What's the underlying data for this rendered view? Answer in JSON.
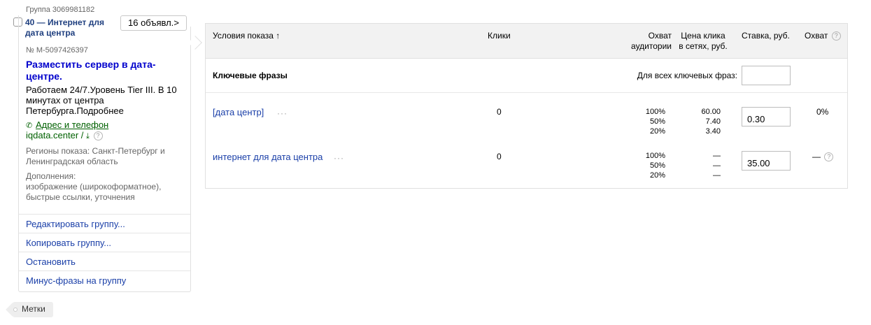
{
  "group": {
    "id_label": "Группа 3069981182",
    "name": "40 — Интернет для дата центра",
    "ads_button": "16 объявл.",
    "ads_chevron": ">"
  },
  "ad": {
    "number": "№ M-5097426397",
    "title": "Разместить сервер в дата-центре.",
    "text": "Работаем 24/7.Уровень Tier III. В 10 минутах от центра Петербурга.Подробнее",
    "contacts_link": "Адрес и телефон",
    "domain": "iqdata.center /",
    "regions": "Регионы показа: Санкт-Петербург и Ленинградская область",
    "extras_label": "Дополнения:",
    "extras": "изображение (широкоформатное), быстрые ссылки, уточнения",
    "help_glyph": "?"
  },
  "actions": [
    "Редактировать группу...",
    "Копировать группу...",
    "Остановить",
    "Минус-фразы на группу"
  ],
  "tags_label": "Метки",
  "table": {
    "headers": {
      "conditions": "Условия показа",
      "sort_arrow": "↑",
      "clicks": "Клики",
      "reach_line1": "Охват",
      "reach_line2": "аудитории",
      "cpc_line1": "Цена клика",
      "cpc_line2": "в сетях, руб.",
      "bid": "Ставка, руб.",
      "coverage": "Охват",
      "help_glyph": "?"
    },
    "section_title": "Ключевые фразы",
    "all_phrases_label": "Для всех ключевых фраз:",
    "all_phrases_value": "",
    "more_glyph": "···",
    "rows": [
      {
        "keyword": "[дата центр]",
        "clicks": "0",
        "reach": [
          "100%",
          "50%",
          "20%"
        ],
        "cpc": [
          "60.00",
          "7.40",
          "3.40"
        ],
        "bid": "0.30",
        "coverage": "0%"
      },
      {
        "keyword": "интернет для дата центра",
        "clicks": "0",
        "reach": [
          "100%",
          "50%",
          "20%"
        ],
        "cpc": [
          "—",
          "—",
          "—"
        ],
        "bid": "35.00",
        "coverage": "—"
      }
    ]
  },
  "colors": {
    "link": "#1a3fa8",
    "ad_title": "#0000cc",
    "contacts": "#006000",
    "header_bg": "#f2f2f2"
  },
  "icons": {
    "phone": "phone-icon",
    "download": "download-icon",
    "help": "help-icon"
  }
}
